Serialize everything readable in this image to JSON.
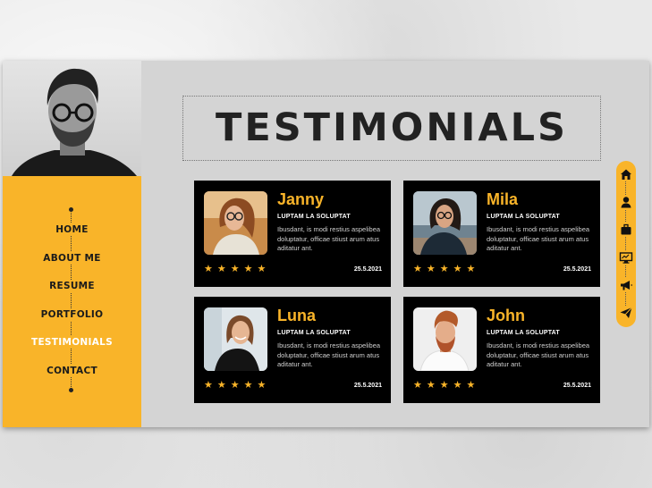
{
  "nav": {
    "items": [
      {
        "label": "HOME",
        "active": false
      },
      {
        "label": "ABOUT ME",
        "active": false
      },
      {
        "label": "RESUME",
        "active": false
      },
      {
        "label": "PORTFOLIO",
        "active": false
      },
      {
        "label": "TESTIMONIALS",
        "active": true
      },
      {
        "label": "CONTACT",
        "active": false
      }
    ]
  },
  "page": {
    "title": "TESTIMONIALS"
  },
  "testimonials": [
    {
      "name": "Janny",
      "role": "LUPTAM LA SOLUPTAT",
      "text": "Ibusdant, is modi restius aspelibea doluptatur, officae stiust arum atus aditatur ant.",
      "stars": "★★★★★",
      "rating": 5,
      "date": "25.5.2021"
    },
    {
      "name": "Mila",
      "role": "LUPTAM LA SOLUPTAT",
      "text": "Ibusdant, is modi restius aspelibea doluptatur, officae stiust arum atus aditatur ant.",
      "stars": "★★★★★",
      "rating": 5,
      "date": "25.5.2021"
    },
    {
      "name": "Luna",
      "role": "LUPTAM LA SOLUPTAT",
      "text": "Ibusdant, is modi restius aspelibea doluptatur, officae stiust arum atus aditatur ant.",
      "stars": "★★★★★",
      "rating": 5,
      "date": "25.5.2021"
    },
    {
      "name": "John",
      "role": "LUPTAM LA SOLUPTAT",
      "text": "Ibusdant, is modi restius aspelibea doluptatur, officae stiust arum atus aditatur ant.",
      "stars": "★★★★★",
      "rating": 5,
      "date": "25.5.2021"
    }
  ],
  "iconbar": [
    "home-icon",
    "user-icon",
    "briefcase-icon",
    "monitor-icon",
    "megaphone-icon",
    "send-icon"
  ],
  "colors": {
    "accent": "#f9b429",
    "card": "#000000",
    "panel": "#d4d4d4"
  }
}
